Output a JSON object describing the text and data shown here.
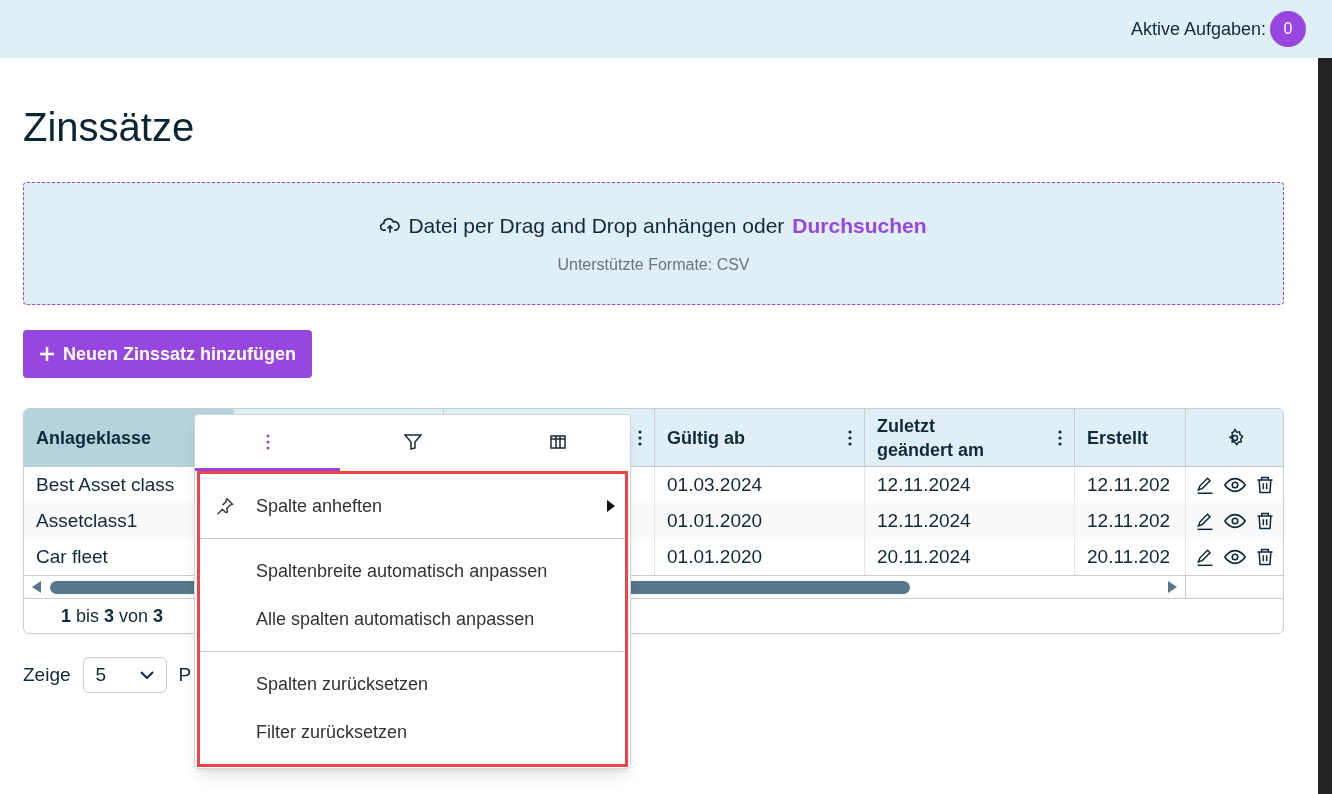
{
  "header": {
    "tasks_label": "Aktive Aufgaben:",
    "tasks_count": "0"
  },
  "title": "Zinssätze",
  "upload": {
    "text": "Datei per Drag and Drop anhängen oder",
    "link": "Durchsuchen",
    "hint": "Unterstützte Formate: CSV"
  },
  "add_button": "Neuen Zinssatz hinzufügen",
  "table": {
    "columns": [
      {
        "label": "Anlageklasse",
        "selected": true,
        "menu": false
      },
      {
        "selected": false
      },
      {
        "selected": false,
        "menu": true
      },
      {
        "label": "Gültig ab",
        "selected": false,
        "menu": true
      },
      {
        "label": "Zuletzt geändert am",
        "selected": false,
        "menu": true
      },
      {
        "label": "Erstellt",
        "selected": false,
        "menu": false
      }
    ],
    "rows": [
      [
        "Best Asset class",
        "",
        "",
        "01.03.2024",
        "12.11.2024",
        "12.11.202"
      ],
      [
        "Assetclass1",
        "",
        "",
        "01.01.2020",
        "12.11.2024",
        "12.11.202"
      ],
      [
        "Car fleet",
        "",
        "",
        "01.01.2020",
        "20.11.2024",
        "20.11.202"
      ]
    ],
    "footer": {
      "from": "1",
      "mid": "bis",
      "to": "3",
      "of": "von",
      "total": "3"
    }
  },
  "pager": {
    "label": "Zeige",
    "size": "5",
    "after": "P"
  },
  "menu": {
    "tabs": [
      {
        "kind": "general",
        "selected": true
      },
      {
        "kind": "filter",
        "selected": false
      },
      {
        "kind": "columns",
        "selected": false
      }
    ],
    "groups": [
      [
        {
          "label": "Spalte anheften",
          "kind": "submenu"
        }
      ],
      [
        {
          "label": "Spaltenbreite automatisch anpassen",
          "kind": "action"
        },
        {
          "label": "Alle spalten automatisch anpassen",
          "kind": "action"
        }
      ],
      [
        {
          "label": "Spalten zurücksetzen",
          "kind": "action"
        },
        {
          "label": "Filter zurücksetzen",
          "kind": "action"
        }
      ]
    ]
  }
}
